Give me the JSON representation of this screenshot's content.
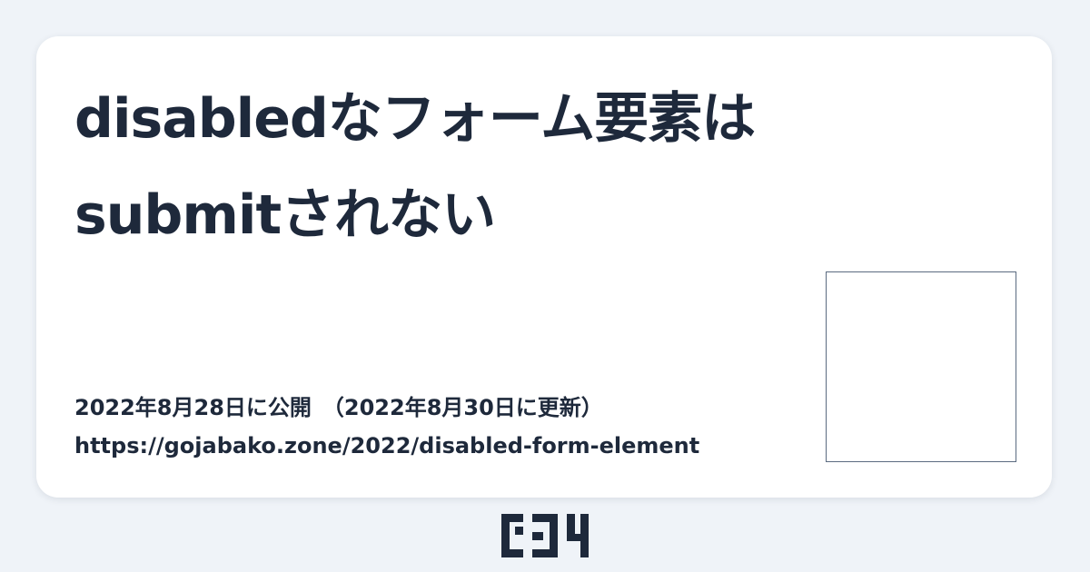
{
  "post": {
    "title_line1": "disabledなフォーム要素は",
    "title_line2": "submitされない",
    "published": "2022年8月28日に公開",
    "updated": "（2022年8月30日に更新）",
    "url": "https://gojabako.zone/2022/disabled-form-element"
  },
  "logo": {
    "icon": "gojabako-logo-icon",
    "color": "#1e293b"
  },
  "colors": {
    "background": "#eff3f8",
    "card": "#ffffff",
    "text": "#1e293b",
    "thumbnail_border": "#5b6b80"
  }
}
